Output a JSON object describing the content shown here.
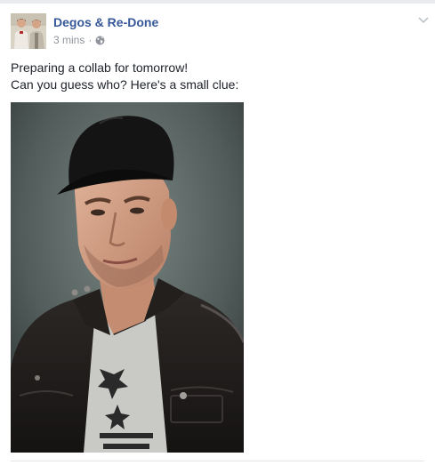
{
  "post": {
    "author": "Degos & Re-Done",
    "time": "3 mins",
    "separator": "·",
    "privacy_icon": "globe-icon",
    "options_icon": "chevron-down-icon",
    "text_lines": [
      "Preparing a collab for tomorrow!",
      "Can you guess who? Here's a small clue:"
    ],
    "photo_subject": "man-in-black-cap-and-leather-jacket"
  },
  "colors": {
    "author_link": "#365899",
    "meta_text": "#90949c",
    "body_text": "#1d2129",
    "photo_background": "#596563"
  }
}
